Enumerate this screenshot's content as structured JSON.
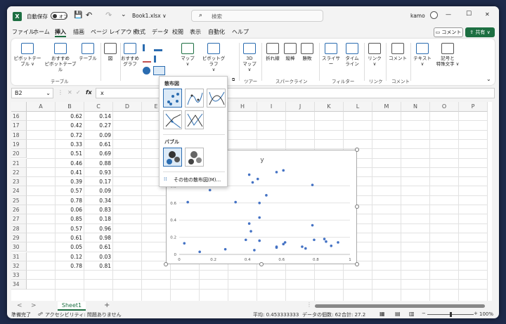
{
  "titlebar": {
    "app_icon": "X",
    "autosave_label": "自動保存",
    "autosave_state": "オフ",
    "filename": "Book1.xlsx ∨",
    "search_placeholder": "検索",
    "user": "kamo",
    "minimize": "—",
    "maximize": "☐",
    "close": "✕"
  },
  "menu": {
    "items": [
      "ファイル",
      "ホーム",
      "挿入",
      "描画",
      "ページ レイアウト",
      "数式",
      "データ",
      "校閲",
      "表示",
      "自動化",
      "ヘルプ"
    ],
    "active": "挿入",
    "comment_button": "コメント",
    "share_button": "共有"
  },
  "ribbon": {
    "pivot_table": "ピボットテー\nブル ∨",
    "recommended_pivot": "おすすめ\nピボットテーブル",
    "table": "テーブル",
    "group_table": "テーブル",
    "illust": "図",
    "recommended_chart": "おすすめ\nグラフ",
    "map": "マップ\n∨",
    "pivot_chart": "ピボットグラフ\n∨",
    "map3d": "3D\nマップ ∨",
    "group_tour": "ツアー",
    "sparkline_line": "折れ線",
    "sparkline_column": "縦棒",
    "sparkline_winloss": "勝敗",
    "group_sparkline": "スパークライン",
    "slicer": "スライサー",
    "timeline": "タイム\nライン",
    "group_filter": "フィルター",
    "link": "リンク\n∨",
    "group_link": "リンク",
    "comment": "コメント",
    "group_comment": "コメント",
    "text": "テキスト\n∨",
    "symbol": "記号と\n特殊文字 ∨"
  },
  "formula_bar": {
    "name_box": "B2",
    "fx": "fx",
    "formula": "x"
  },
  "columns": [
    "A",
    "B",
    "C",
    "D",
    "E",
    "F",
    "G",
    "H",
    "I",
    "J",
    "K",
    "L",
    "M",
    "N",
    "O",
    "P"
  ],
  "rows": [
    {
      "n": "16",
      "b": "0.62",
      "c": "0.14"
    },
    {
      "n": "17",
      "b": "0.42",
      "c": "0.27"
    },
    {
      "n": "18",
      "b": "0.72",
      "c": "0.09"
    },
    {
      "n": "19",
      "b": "0.33",
      "c": "0.61"
    },
    {
      "n": "20",
      "b": "0.51",
      "c": "0.69"
    },
    {
      "n": "21",
      "b": "0.46",
      "c": "0.88"
    },
    {
      "n": "22",
      "b": "0.41",
      "c": "0.93"
    },
    {
      "n": "23",
      "b": "0.39",
      "c": "0.17"
    },
    {
      "n": "24",
      "b": "0.57",
      "c": "0.09"
    },
    {
      "n": "25",
      "b": "0.78",
      "c": "0.34"
    },
    {
      "n": "26",
      "b": "0.06",
      "c": "0.83"
    },
    {
      "n": "27",
      "b": "0.85",
      "c": "0.18"
    },
    {
      "n": "28",
      "b": "0.57",
      "c": "0.96"
    },
    {
      "n": "29",
      "b": "0.61",
      "c": "0.98"
    },
    {
      "n": "30",
      "b": "0.05",
      "c": "0.61"
    },
    {
      "n": "31",
      "b": "0.12",
      "c": "0.03"
    },
    {
      "n": "32",
      "b": "0.78",
      "c": "0.81"
    },
    {
      "n": "33",
      "b": "",
      "c": ""
    },
    {
      "n": "34",
      "b": "",
      "c": ""
    }
  ],
  "dropdown": {
    "scatter_section": "散布図",
    "bubble_section": "バブル",
    "more_link": "その他の散布図(M)..."
  },
  "chart_data": {
    "type": "scatter",
    "title": "y",
    "xlim": [
      0,
      1
    ],
    "ylim": [
      0,
      1
    ],
    "x_ticks": [
      "0",
      "0.2",
      "0.4",
      "0.6",
      "0.8",
      "1"
    ],
    "y_ticks": [
      "0",
      "0.2",
      "0.4",
      "0.6",
      "0.8"
    ],
    "points": [
      [
        0.62,
        0.14
      ],
      [
        0.42,
        0.27
      ],
      [
        0.72,
        0.09
      ],
      [
        0.33,
        0.61
      ],
      [
        0.51,
        0.69
      ],
      [
        0.46,
        0.88
      ],
      [
        0.41,
        0.93
      ],
      [
        0.39,
        0.17
      ],
      [
        0.57,
        0.09
      ],
      [
        0.78,
        0.34
      ],
      [
        0.06,
        0.83
      ],
      [
        0.85,
        0.18
      ],
      [
        0.57,
        0.96
      ],
      [
        0.61,
        0.98
      ],
      [
        0.05,
        0.61
      ],
      [
        0.12,
        0.03
      ],
      [
        0.78,
        0.81
      ],
      [
        0.03,
        0.13
      ],
      [
        0.18,
        0.83
      ],
      [
        0.18,
        0.75
      ],
      [
        0.27,
        0.06
      ],
      [
        0.41,
        0.36
      ],
      [
        0.44,
        0.05
      ],
      [
        0.47,
        0.6
      ],
      [
        0.47,
        0.43
      ],
      [
        0.47,
        0.16
      ],
      [
        0.57,
        0.08
      ],
      [
        0.61,
        0.12
      ],
      [
        0.74,
        0.07
      ],
      [
        0.79,
        0.17
      ],
      [
        0.86,
        0.15
      ],
      [
        0.89,
        0.1
      ],
      [
        0.93,
        0.14
      ],
      [
        0.43,
        0.84
      ]
    ]
  },
  "sheet_tabs": {
    "prev": "<",
    "next": ">",
    "active": "Sheet1",
    "add": "+"
  },
  "status": {
    "ready": "準備完了",
    "accessibility": "アクセシビリティ: 問題ありません",
    "average": "平均: 0.453333333",
    "count": "データの個数: 62",
    "sum": "合計: 27.2",
    "zoom": "100%"
  }
}
